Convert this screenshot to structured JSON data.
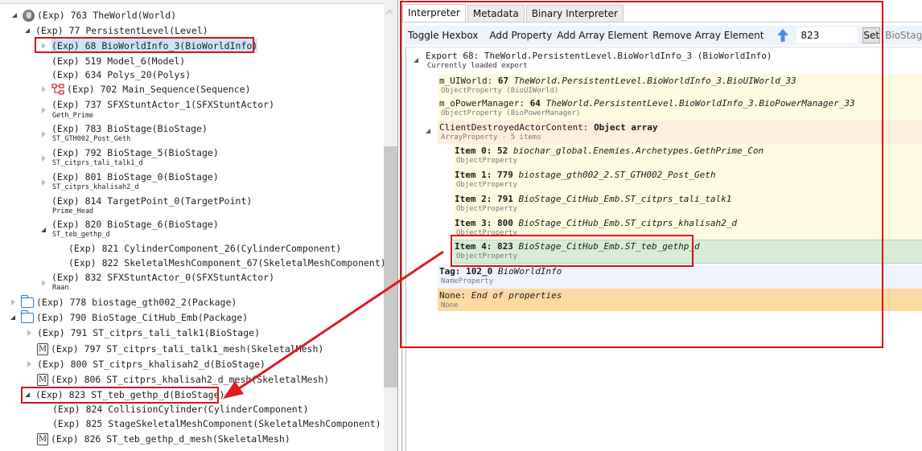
{
  "tree": {
    "nodes": [
      {
        "prefix": "(Exp)",
        "index": "763",
        "name": "TheWorld(World)",
        "icon": "globe-icon",
        "state": "expanded"
      },
      {
        "prefix": "(Exp)",
        "index": "77",
        "name": "PersistentLevel(Level)",
        "icon": null,
        "state": "expanded"
      },
      {
        "prefix": "(Exp)",
        "index": "68",
        "name": "BioWorldInfo_3(BioWorldInfo)",
        "icon": null,
        "state": "collapsed",
        "selected": true
      },
      {
        "prefix": "(Exp)",
        "index": "519",
        "name": "Model_6(Model)",
        "icon": null,
        "state": "none"
      },
      {
        "prefix": "(Exp)",
        "index": "634",
        "name": "Polys_20(Polys)",
        "icon": null,
        "state": "none"
      },
      {
        "prefix": "(Exp)",
        "index": "702",
        "name": "Main_Sequence(Sequence)",
        "icon": "sequence-icon",
        "state": "collapsed"
      },
      {
        "prefix": "(Exp)",
        "index": "737",
        "name": "SFXStuntActor_1(SFXStuntActor)",
        "sub": "Geth_Prime",
        "state": "collapsed"
      },
      {
        "prefix": "(Exp)",
        "index": "783",
        "name": "BioStage(BioStage)",
        "sub": "ST_GTH002_Post_Geth",
        "state": "collapsed"
      },
      {
        "prefix": "(Exp)",
        "index": "792",
        "name": "BioStage_5(BioStage)",
        "sub": "ST_citprs_tali_talk1_d",
        "state": "collapsed"
      },
      {
        "prefix": "(Exp)",
        "index": "801",
        "name": "BioStage_0(BioStage)",
        "sub": "ST_citprs_khalisah2_d",
        "state": "collapsed"
      },
      {
        "prefix": "(Exp)",
        "index": "814",
        "name": "TargetPoint_0(TargetPoint)",
        "sub": "Prime_Head",
        "state": "none"
      },
      {
        "prefix": "(Exp)",
        "index": "820",
        "name": "BioStage_6(BioStage)",
        "sub": "ST_teb_gethp_d",
        "state": "expanded"
      },
      {
        "prefix": "(Exp)",
        "index": "821",
        "name": "CylinderComponent_26(CylinderComponent)",
        "state": "none"
      },
      {
        "prefix": "(Exp)",
        "index": "822",
        "name": "SkeletalMeshComponent_67(SkeletalMeshComponent)",
        "state": "none"
      },
      {
        "prefix": "(Exp)",
        "index": "832",
        "name": "SFXStuntActor_0(SFXStuntActor)",
        "sub": "Raan",
        "state": "collapsed"
      },
      {
        "prefix": "(Exp)",
        "index": "778",
        "name": "biostage_gth002_2(Package)",
        "icon": "folder-icon",
        "state": "collapsed"
      },
      {
        "prefix": "(Exp)",
        "index": "790",
        "name": "BioStage_CitHub_Emb(Package)",
        "icon": "folder-icon",
        "state": "expanded"
      },
      {
        "prefix": "(Exp)",
        "index": "791",
        "name": "ST_citprs_tali_talk1(BioStage)",
        "state": "collapsed"
      },
      {
        "prefix": "(Exp)",
        "index": "797",
        "name": "ST_citprs_tali_talk1_mesh(SkeletalMesh)",
        "icon": "mesh-icon",
        "state": "none"
      },
      {
        "prefix": "(Exp)",
        "index": "800",
        "name": "ST_citprs_khalisah2_d(BioStage)",
        "state": "collapsed"
      },
      {
        "prefix": "(Exp)",
        "index": "806",
        "name": "ST_citprs_khalisah2_d_mesh(SkeletalMesh)",
        "icon": "mesh-icon",
        "state": "none"
      },
      {
        "prefix": "(Exp)",
        "index": "823",
        "name": "ST_teb_gethp_d(BioStage)",
        "state": "expanded"
      },
      {
        "prefix": "(Exp)",
        "index": "824",
        "name": "CollisionCylinder(CylinderComponent)",
        "state": "none"
      },
      {
        "prefix": "(Exp)",
        "index": "825",
        "name": "StageSkeletalMeshComponent(SkeletalMeshComponent)",
        "state": "none"
      },
      {
        "prefix": "(Exp)",
        "index": "826",
        "name": "ST_teb_gethp_d_mesh(SkeletalMesh)",
        "icon": "mesh-icon",
        "state": "none"
      }
    ],
    "mesh_glyph": "M"
  },
  "right": {
    "tabs": [
      {
        "label": "Interpreter",
        "active": true
      },
      {
        "label": "Metadata",
        "active": false
      },
      {
        "label": "Binary Interpreter",
        "active": false
      }
    ],
    "toolbar": {
      "toggle_hexbox": "Toggle Hexbox",
      "add_property": "Add Property",
      "add_array_element": "Add Array Element",
      "remove_array_element": "Remove Array Element",
      "goto_value": "823",
      "set_label": "Set",
      "resolved_path": "BioStage_CitHub_Emb.ST_teb_gethp_d"
    },
    "export": {
      "header": "Export 68: TheWorld.PersistentLevel.BioWorldInfo_3 (BioWorldInfo)",
      "subheader": "Currently loaded export"
    },
    "properties": [
      {
        "name": "m_UIWorld:",
        "value": "67",
        "ref": "TheWorld.PersistentLevel.BioWorldInfo_3.BioUIWorld_33",
        "type": "ObjectProperty (BioUIWorld)"
      },
      {
        "name": "m_oPowerManager:",
        "value": "64",
        "ref": "TheWorld.PersistentLevel.BioWorldInfo_3.BioPowerManager_33",
        "type": "ObjectProperty (BioPowerManager)"
      },
      {
        "name": "ClientDestroyedActorContent:",
        "value": "Object array",
        "ref": "",
        "type": "ArrayProperty - 5 items"
      }
    ],
    "array_items": [
      {
        "name": "Item 0:",
        "value": "52",
        "ref": "biochar_global.Enemies.Archetypes.GethPrime_Con",
        "type": "ObjectProperty"
      },
      {
        "name": "Item 1:",
        "value": "779",
        "ref": "biostage_gth002_2.ST_GTH002_Post_Geth",
        "type": "ObjectProperty"
      },
      {
        "name": "Item 2:",
        "value": "791",
        "ref": "BioStage_CitHub_Emb.ST_citprs_tali_talk1",
        "type": "ObjectProperty"
      },
      {
        "name": "Item 3:",
        "value": "800",
        "ref": "BioStage_CitHub_Emb.ST_citprs_khalisah2_d",
        "type": "ObjectProperty"
      },
      {
        "name": "Item 4:",
        "value": "823",
        "ref": "BioStage_CitHub_Emb.ST_teb_gethp_d",
        "type": "ObjectProperty"
      }
    ],
    "tag": {
      "name": "Tag:",
      "value": "102_0",
      "ref": "BioWorldInfo",
      "type": "NameProperty"
    },
    "none": {
      "name": "None:",
      "ref": "End of properties",
      "type": "None"
    }
  },
  "colors": {
    "annotation_red": "#d6131b",
    "selection_blue": "#cce4f7",
    "folder_blue": "#2b7bd6",
    "row_yellow": "#fffbe0",
    "row_peach": "#fdeedd",
    "row_green": "#d9ecd6",
    "row_blue": "#eff4fd",
    "row_orange": "#fed9a4"
  }
}
